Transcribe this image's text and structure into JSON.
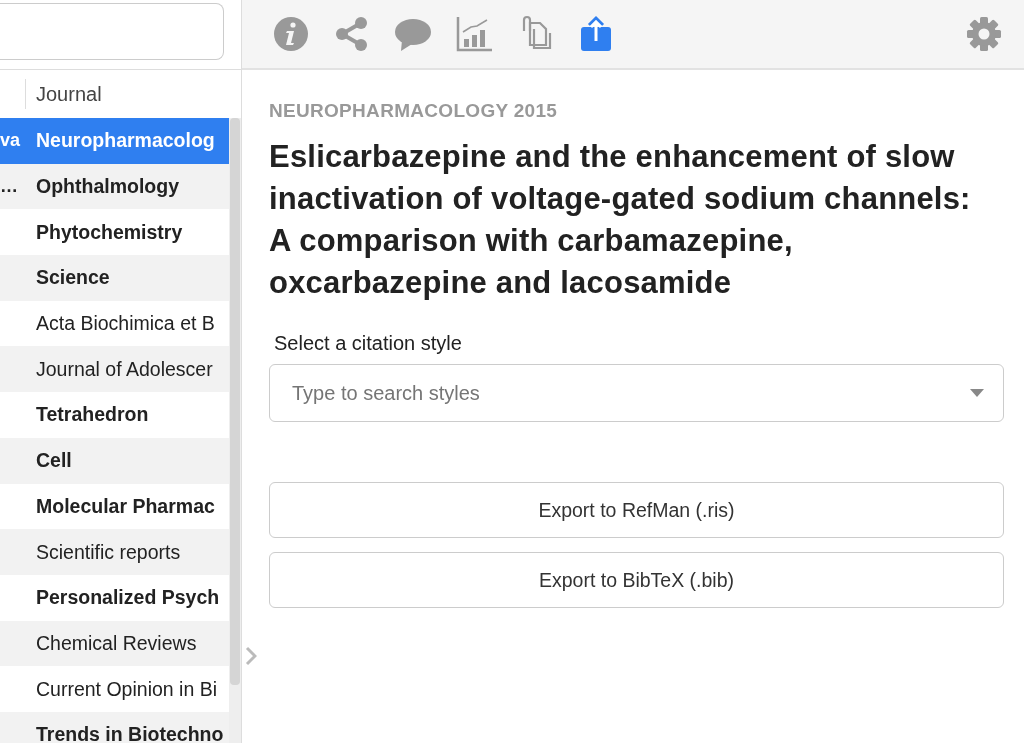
{
  "sidebar": {
    "columns": [
      "Journal"
    ],
    "rows": [
      {
        "column_1": "va",
        "journal": "Neuropharmacolog",
        "unread": true,
        "selected": true
      },
      {
        "column_1": "…",
        "journal": "Ophthalmology",
        "unread": true,
        "selected": false
      },
      {
        "column_1": "",
        "journal": "Phytochemistry",
        "unread": true,
        "selected": false
      },
      {
        "column_1": "",
        "journal": "Science",
        "unread": true,
        "selected": false
      },
      {
        "column_1": "",
        "journal": "Acta Biochimica et B",
        "unread": false,
        "selected": false
      },
      {
        "column_1": "",
        "journal": "Journal of Adolescer",
        "unread": false,
        "selected": false
      },
      {
        "column_1": "",
        "journal": "Tetrahedron",
        "unread": true,
        "selected": false
      },
      {
        "column_1": "",
        "journal": "Cell",
        "unread": true,
        "selected": false
      },
      {
        "column_1": "",
        "journal": "Molecular Pharmac",
        "unread": true,
        "selected": false
      },
      {
        "column_1": "",
        "journal": "Scientific reports",
        "unread": false,
        "selected": false
      },
      {
        "column_1": "",
        "journal": "Personalized Psych",
        "unread": true,
        "selected": false
      },
      {
        "column_1": "",
        "journal": "Chemical Reviews",
        "unread": false,
        "selected": false
      },
      {
        "column_1": "",
        "journal": "Current Opinion in Bi",
        "unread": false,
        "selected": false
      },
      {
        "column_1": "",
        "journal": "Trends in Biotechno",
        "unread": true,
        "selected": false
      }
    ]
  },
  "toolbar": {
    "tools": [
      {
        "kind": "info",
        "selected": false
      },
      {
        "kind": "share",
        "selected": false
      },
      {
        "kind": "comment",
        "selected": false
      },
      {
        "kind": "chart",
        "selected": false
      },
      {
        "kind": "attachment",
        "selected": false
      },
      {
        "kind": "export",
        "selected": true
      }
    ]
  },
  "detail": {
    "source": "NEUROPHARMACOLOGY 2015",
    "title": "Eslicarbazepine and the enhancement of slow inactivation of voltage-gated sodium channels: A comparison with carbamazepine, oxcarbazepine and lacosamide",
    "citation_label": "Select a citation style",
    "citation_placeholder": "Type to search styles",
    "buttons": [
      "Export to RefMan (.ris)",
      "Export to BibTeX (.bib)"
    ]
  }
}
